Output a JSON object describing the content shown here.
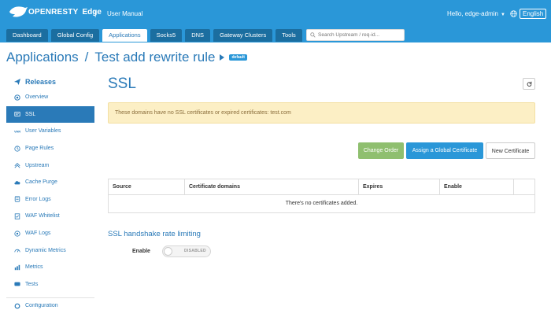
{
  "brand": {
    "logo": "OPENRESTY",
    "product": "Edge"
  },
  "topbar": {
    "separator": "|",
    "manual_link": "User Manual",
    "greeting": "Hello, edge-admin",
    "language": "English"
  },
  "nav": {
    "tabs": [
      "Dashboard",
      "Global Config",
      "Applications",
      "Socks5",
      "DNS",
      "Gateway Clusters",
      "Tools"
    ],
    "active_tab": "Applications",
    "search_placeholder": "Search Upstream / req-id..."
  },
  "header": {
    "crumb_root": "Applications",
    "crumb_sep": "/",
    "crumb_current": "Test add rewrite rule",
    "badge": "default"
  },
  "sidebar": {
    "title": "Releases",
    "items": [
      {
        "label": "Overview",
        "icon": "eye-icon"
      },
      {
        "label": "SSL",
        "icon": "certificate-icon",
        "active": true
      },
      {
        "label": "User Variables",
        "icon": "var-icon"
      },
      {
        "label": "Page Rules",
        "icon": "rules-icon"
      },
      {
        "label": "Upstream",
        "icon": "upstream-icon"
      },
      {
        "label": "Cache Purge",
        "icon": "cloud-icon"
      },
      {
        "label": "Error Logs",
        "icon": "error-log-icon"
      },
      {
        "label": "WAF Whitelist",
        "icon": "whitelist-icon"
      },
      {
        "label": "WAF Logs",
        "icon": "waf-log-icon"
      },
      {
        "label": "Dynamic Metrics",
        "icon": "dynamic-metrics-icon"
      },
      {
        "label": "Metrics",
        "icon": "metrics-icon"
      },
      {
        "label": "Tests",
        "icon": "tests-icon"
      }
    ],
    "next_section": "Configuration"
  },
  "main": {
    "title": "SSL",
    "alert": "These domains have no SSL certificates or expired certificates: test.com",
    "buttons": {
      "change_order": "Change Order",
      "assign_global": "Assign a Global Certificate",
      "new_certificate": "New Certificate"
    },
    "table": {
      "columns": [
        "Source",
        "Certificate domains",
        "Expires",
        "Enable",
        ""
      ],
      "empty_text": "There's no certificates added."
    },
    "rate_limit": {
      "title": "SSL handshake rate limiting",
      "enable_label": "Enable",
      "toggle_state": "DISABLED"
    }
  },
  "colors": {
    "primary": "#2a97d8",
    "link": "#2a7ab8",
    "alert_bg": "#fcefc5",
    "change_order": "#8fbf6f"
  }
}
